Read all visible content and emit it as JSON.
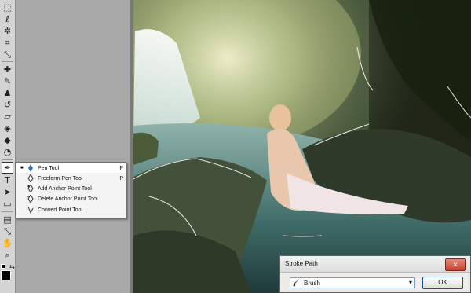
{
  "toolbox": {
    "tools": [
      {
        "name": "marquee-tool-icon",
        "glyph": "⬚"
      },
      {
        "name": "lasso-tool-icon",
        "glyph": "ℓ"
      },
      {
        "name": "magic-wand-tool-icon",
        "glyph": "✲"
      },
      {
        "name": "crop-tool-icon",
        "glyph": "⌗"
      },
      {
        "name": "eyedropper-tool-icon",
        "glyph": "⤡"
      },
      {
        "name": "healing-brush-tool-icon",
        "glyph": "✚"
      },
      {
        "name": "brush-tool-icon",
        "glyph": "✎"
      },
      {
        "name": "clone-stamp-tool-icon",
        "glyph": "♟"
      },
      {
        "name": "history-brush-tool-icon",
        "glyph": "↺"
      },
      {
        "name": "eraser-tool-icon",
        "glyph": "▱"
      },
      {
        "name": "paint-bucket-tool-icon",
        "glyph": "◈"
      },
      {
        "name": "blur-tool-icon",
        "glyph": "◆"
      },
      {
        "name": "dodge-tool-icon",
        "glyph": "◔"
      },
      {
        "name": "pen-tool-icon",
        "glyph": "✒"
      },
      {
        "name": "type-tool-icon",
        "glyph": "T"
      },
      {
        "name": "path-selection-tool-icon",
        "glyph": "➤"
      },
      {
        "name": "rectangle-tool-icon",
        "glyph": "▭"
      },
      {
        "name": "notes-tool-icon",
        "glyph": "▤"
      },
      {
        "name": "eyedropper2-tool-icon",
        "glyph": "⤡"
      },
      {
        "name": "hand-tool-icon",
        "glyph": "✋"
      },
      {
        "name": "zoom-tool-icon",
        "glyph": "⌕"
      }
    ],
    "foreground_color": "#000000"
  },
  "flyout": {
    "items": [
      {
        "label": "Pen Tool",
        "shortcut": "P",
        "selected": true
      },
      {
        "label": "Freeform Pen Tool",
        "shortcut": "P",
        "selected": false
      },
      {
        "label": "Add Anchor Point Tool",
        "shortcut": "",
        "selected": false
      },
      {
        "label": "Delete Anchor Point Tool",
        "shortcut": "",
        "selected": false
      },
      {
        "label": "Convert Point Tool",
        "shortcut": "",
        "selected": false
      }
    ],
    "selected_bullet": "■"
  },
  "dialog": {
    "title": "Stroke Path",
    "close_glyph": "✕",
    "tool_value": "Brush",
    "dropdown_glyph": "▾",
    "ok_label": "OK"
  },
  "colors": {
    "toolbox_bg": "#d4d4d4",
    "workspace_bg": "#a8a8a8",
    "close_button": "#c7402b",
    "ok_border": "#1d4f8c"
  }
}
